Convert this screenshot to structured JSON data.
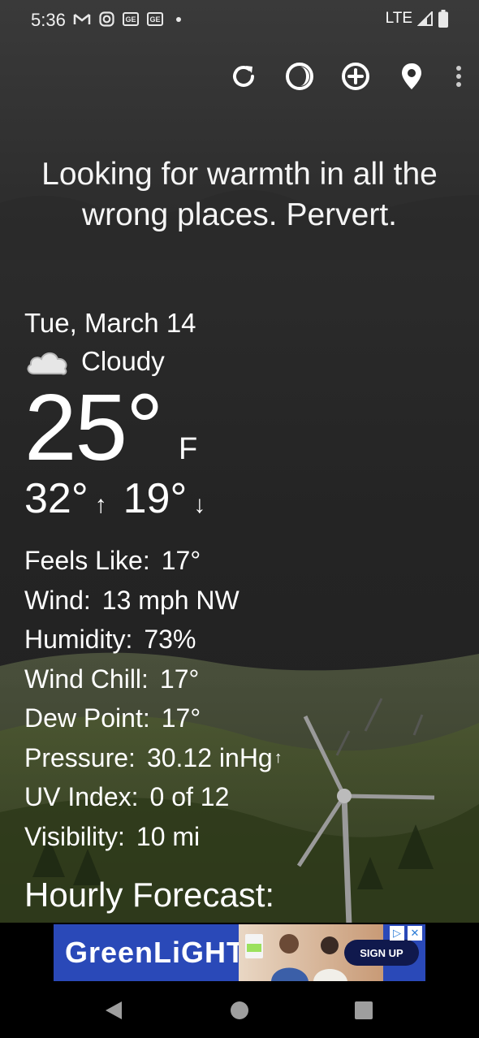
{
  "status": {
    "time": "5:36",
    "notification_icons": [
      "gmail-icon",
      "instagram-icon",
      "news-icon",
      "news-icon",
      "dot-icon"
    ],
    "network": "LTE"
  },
  "toolbar": {
    "actions": [
      "refresh-icon",
      "theme-icon",
      "add-location-icon",
      "location-pin-icon",
      "more-options-icon"
    ]
  },
  "headline": "Looking for warmth in all the wrong places. Pervert.",
  "weather": {
    "date": "Tue, March 14",
    "condition": "Cloudy",
    "condition_icon": "cloud-icon",
    "temperature": "25°",
    "unit": "F",
    "high": "32°",
    "low": "19°",
    "details": [
      {
        "label": "Feels Like:",
        "value": "17°"
      },
      {
        "label": "Wind:",
        "value": "13 mph NW"
      },
      {
        "label": "Humidity:",
        "value": "73%"
      },
      {
        "label": "Wind Chill:",
        "value": "17°"
      },
      {
        "label": "Dew Point:",
        "value": "17°"
      },
      {
        "label": "Pressure:",
        "value": "30.12 inHg"
      },
      {
        "label": "UV Index:",
        "value": "0 of 12"
      },
      {
        "label": "Visibility:",
        "value": "10 mi"
      }
    ]
  },
  "hourly_title": "Hourly Forecast:",
  "ad": {
    "brand": "GreenLiGHT",
    "cta": "SIGN UP"
  },
  "colors": {
    "sky": "#262626",
    "hills": "#5c6b3d",
    "ad_background": "#2a49b8"
  }
}
